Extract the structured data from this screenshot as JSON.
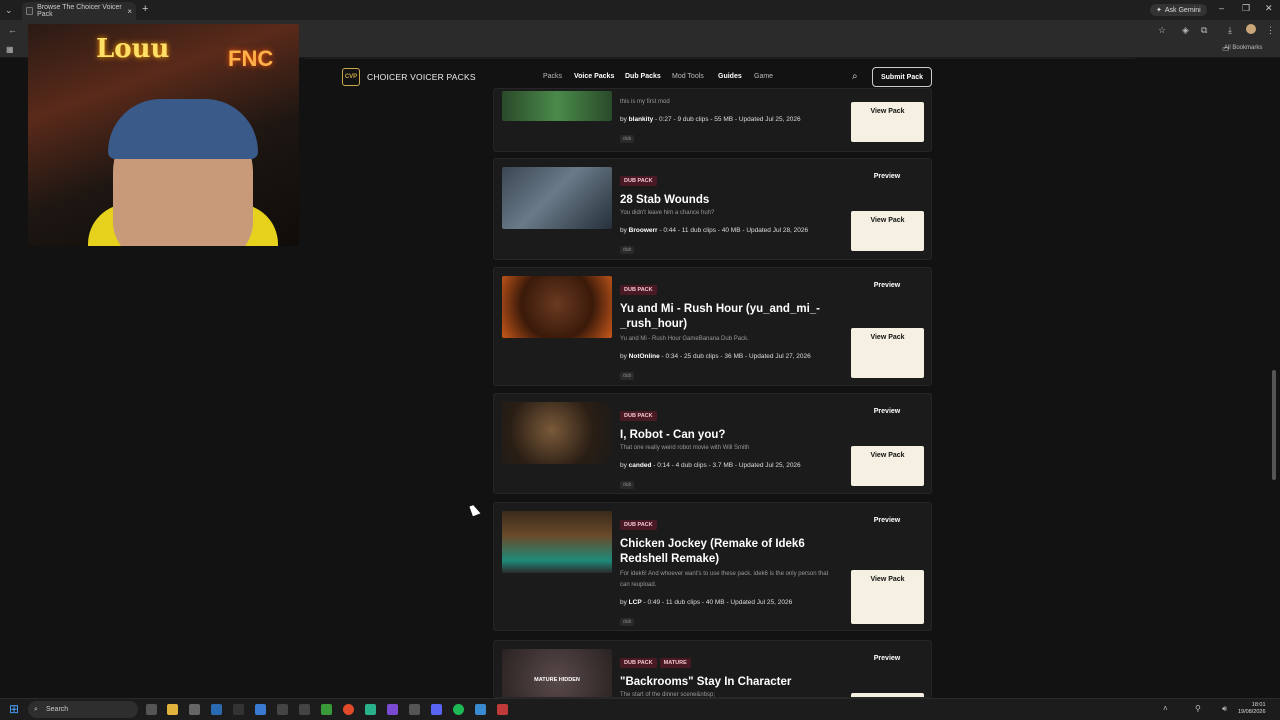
{
  "browser": {
    "tab_title": "Browse The Choicer Voicer Pack",
    "new_tab": "+",
    "ask_gemini": "Ask Gemini",
    "all_bookmarks": "All Bookmarks"
  },
  "site": {
    "logo": "CVP",
    "brand": "CHOICER VOICER PACKS",
    "nav": [
      "Packs",
      "Voice Packs",
      "Dub Packs",
      "Mod Tools",
      "Guides",
      "Game"
    ],
    "submit": "Submit Pack"
  },
  "webcam": {
    "neon_left": "Louu",
    "neon_right": "FNC"
  },
  "cards": [
    {
      "badges": [],
      "title": "",
      "desc": "this is my first mod",
      "author": "blankity",
      "meta": " - 0:27 - 9 dub clips - 55 MB - Updated Jul 25, 2026",
      "tag": "dub",
      "preview": "",
      "view": "View Pack"
    },
    {
      "badges": [
        "DUB PACK"
      ],
      "title": "28 Stab Wounds",
      "desc": "You didn't leave him a chance huh?",
      "author": "Broowerr",
      "meta": " - 0:44 - 11 dub clips - 40 MB - Updated Jul 28, 2026",
      "tag": "dub",
      "preview": "Preview",
      "view": "View Pack"
    },
    {
      "badges": [
        "DUB PACK"
      ],
      "title": "Yu and Mi - Rush Hour (yu_and_mi_-_rush_hour)",
      "desc": "Yu and Mi - Rush Hour GameBanana Dub Pack.",
      "author": "NotOnline",
      "meta": " - 0:34 - 25 dub clips - 36 MB - Updated Jul 27, 2026",
      "tag": "dub",
      "preview": "Preview",
      "view": "View Pack"
    },
    {
      "badges": [
        "DUB PACK"
      ],
      "title": "I, Robot - Can you?",
      "desc": "That one really weird robot movie with Will Smith",
      "author": "canded",
      "meta": " - 0:14 - 4 dub clips - 3.7 MB - Updated Jul 25, 2026",
      "tag": "dub",
      "preview": "Preview",
      "view": "View Pack"
    },
    {
      "badges": [
        "DUB PACK"
      ],
      "title": "Chicken Jockey (Remake of Idek6 Redshell Remake)",
      "desc": "For idek6! And whoever want's to use these pack. idek6  is the only person that can reupload.",
      "author": "LCP",
      "meta": " - 0:49 - 11 dub clips - 40 MB - Updated Jul 25, 2026",
      "tag": "dub",
      "preview": "Preview",
      "view": "View Pack"
    },
    {
      "badges": [
        "DUB PACK",
        "MATURE"
      ],
      "title": "\"Backrooms\" Stay In Character",
      "desc": "The start of the dinner scene&nbsp;",
      "author": "",
      "meta": "",
      "tag": "",
      "preview": "Preview",
      "view": "",
      "thumb_label": "MATURE HIDDEN"
    }
  ],
  "taskbar": {
    "search": "Search",
    "time": "18:01",
    "date": "19/08/2026"
  }
}
